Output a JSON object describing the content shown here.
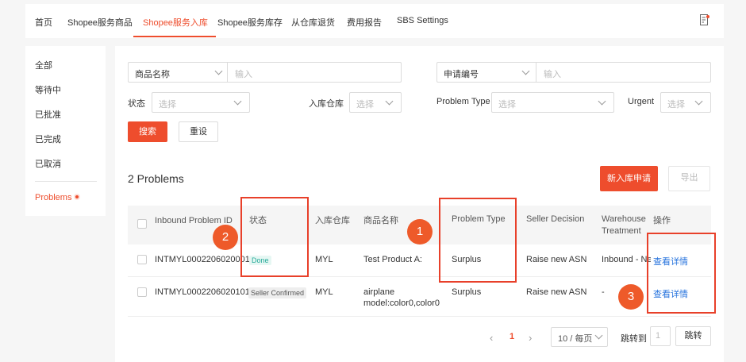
{
  "nav": {
    "tabs": [
      {
        "label": "首页"
      },
      {
        "label": "Shopee服务商品"
      },
      {
        "label": "Shopee服务入库"
      },
      {
        "label": "Shopee服务库存"
      },
      {
        "label": "从仓库退货"
      },
      {
        "label": "费用报告"
      },
      {
        "label": "SBS Settings"
      }
    ],
    "active_tab": "Shopee服务入库",
    "right_icon": "document-edit-icon"
  },
  "sidebar": {
    "items": [
      {
        "label": "全部"
      },
      {
        "label": "等待中"
      },
      {
        "label": "已批准"
      },
      {
        "label": "已完成"
      },
      {
        "label": "已取消"
      }
    ],
    "problems_label": "Problems"
  },
  "filters": {
    "product_name_select": "商品名称",
    "product_name_placeholder": "输入",
    "apply_no_select": "申请编号",
    "apply_no_placeholder": "输入",
    "status_label": "状态",
    "status_placeholder": "选择",
    "warehouse_label": "入库仓库",
    "warehouse_placeholder": "选择",
    "problem_type_label": "Problem Type",
    "problem_type_placeholder": "选择",
    "urgent_label": "Urgent",
    "urgent_placeholder": "选择",
    "search_button": "搜索",
    "reset_button": "重设"
  },
  "results": {
    "count_title": "2 Problems",
    "new_inbound_button": "新入库申请",
    "export_button": "导出"
  },
  "table": {
    "headers": {
      "id": "Inbound Problem ID",
      "status": "状态",
      "warehouse": "入库仓库",
      "product": "商品名称",
      "problem_type": "Problem Type",
      "seller_decision": "Seller Decision",
      "warehouse_treatment_1": "Warehouse",
      "warehouse_treatment_2": "Treatment",
      "action": "操作"
    },
    "rows": [
      {
        "id": "INTMYL0002206020001",
        "status": "Done",
        "warehouse": "MYL",
        "product_1": "Test Product A:",
        "product_2": "",
        "problem_type": "Surplus",
        "seller_decision": "Raise new ASN",
        "warehouse_treatment": "Inbound - New",
        "action": "查看详情"
      },
      {
        "id": "INTMYL0002206020101",
        "status": "Seller Confirmed",
        "warehouse": "MYL",
        "product_1": "airplane",
        "product_2": "model:color0,color0",
        "problem_type": "Surplus",
        "seller_decision": "Raise new ASN",
        "warehouse_treatment": "-",
        "action": "查看详情"
      }
    ]
  },
  "pagination": {
    "current_page": "1",
    "page_size": "10 / 每页",
    "jump_label": "跳转到",
    "jump_value": "1",
    "jump_button": "跳转"
  },
  "annotations": {
    "marker_1": "1",
    "marker_2": "2",
    "marker_3": "3",
    "highlight_color": "#e8402a"
  },
  "colors": {
    "brand": "#ee4d2d",
    "link": "#2673dd",
    "done": "#26aa99"
  }
}
